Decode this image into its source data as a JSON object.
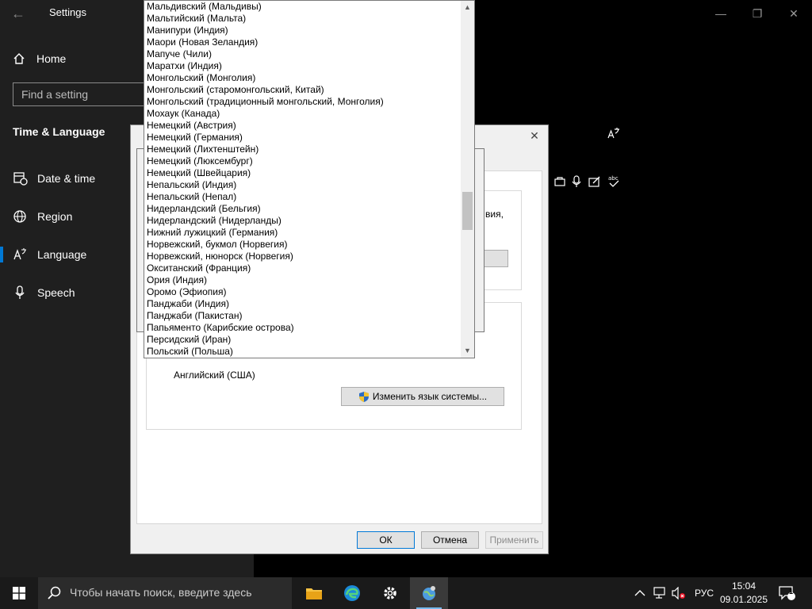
{
  "settings": {
    "title": "Settings",
    "home_label": "Home",
    "search_placeholder": "Find a setting",
    "section_title": "Time & Language",
    "nav": [
      {
        "label": "Date & time",
        "icon": "calendar-clock-icon"
      },
      {
        "label": "Region",
        "icon": "globe-icon"
      },
      {
        "label": "Language",
        "icon": "language-icon",
        "active": true
      },
      {
        "label": "Speech",
        "icon": "microphone-icon"
      }
    ]
  },
  "region_dialog": {
    "fragment_text": "вия,",
    "current_system_language": "Английский (США)",
    "change_system_language_label": "Изменить язык системы...",
    "ok_label": "ОК",
    "cancel_label": "Отмена",
    "apply_label": "Применить"
  },
  "language_list": [
    "Мальдивский (Мальдивы)",
    "Мальтийский (Мальта)",
    "Манипури (Индия)",
    "Маори (Новая Зеландия)",
    "Мапуче (Чили)",
    "Маратхи (Индия)",
    "Монгольский (Монголия)",
    "Монгольский (старомонгольский, Китай)",
    "Монгольский (традиционный монгольский, Монголия)",
    "Мохаук (Канада)",
    "Немецкий (Австрия)",
    "Немецкий (Германия)",
    "Немецкий (Лихтенштейн)",
    "Немецкий (Люксембург)",
    "Немецкий (Швейцария)",
    "Непальский (Индия)",
    "Непальский (Непал)",
    "Нидерландский (Бельгия)",
    "Нидерландский (Нидерланды)",
    "Нижний лужицкий (Германия)",
    "Норвежский, букмол (Норвегия)",
    "Норвежский, нюнорск (Норвегия)",
    "Окситанский (Франция)",
    "Ория (Индия)",
    "Оромо (Эфиопия)",
    "Панджаби (Индия)",
    "Панджаби (Пакистан)",
    "Папьяменто (Карибские острова)",
    "Персидский (Иран)",
    "Польский (Польша)"
  ],
  "taskbar": {
    "search_placeholder": "Чтобы начать поиск, введите здесь",
    "input_language": "РУС",
    "time": "15:04",
    "date": "09.01.2025",
    "notification_count": "1"
  }
}
